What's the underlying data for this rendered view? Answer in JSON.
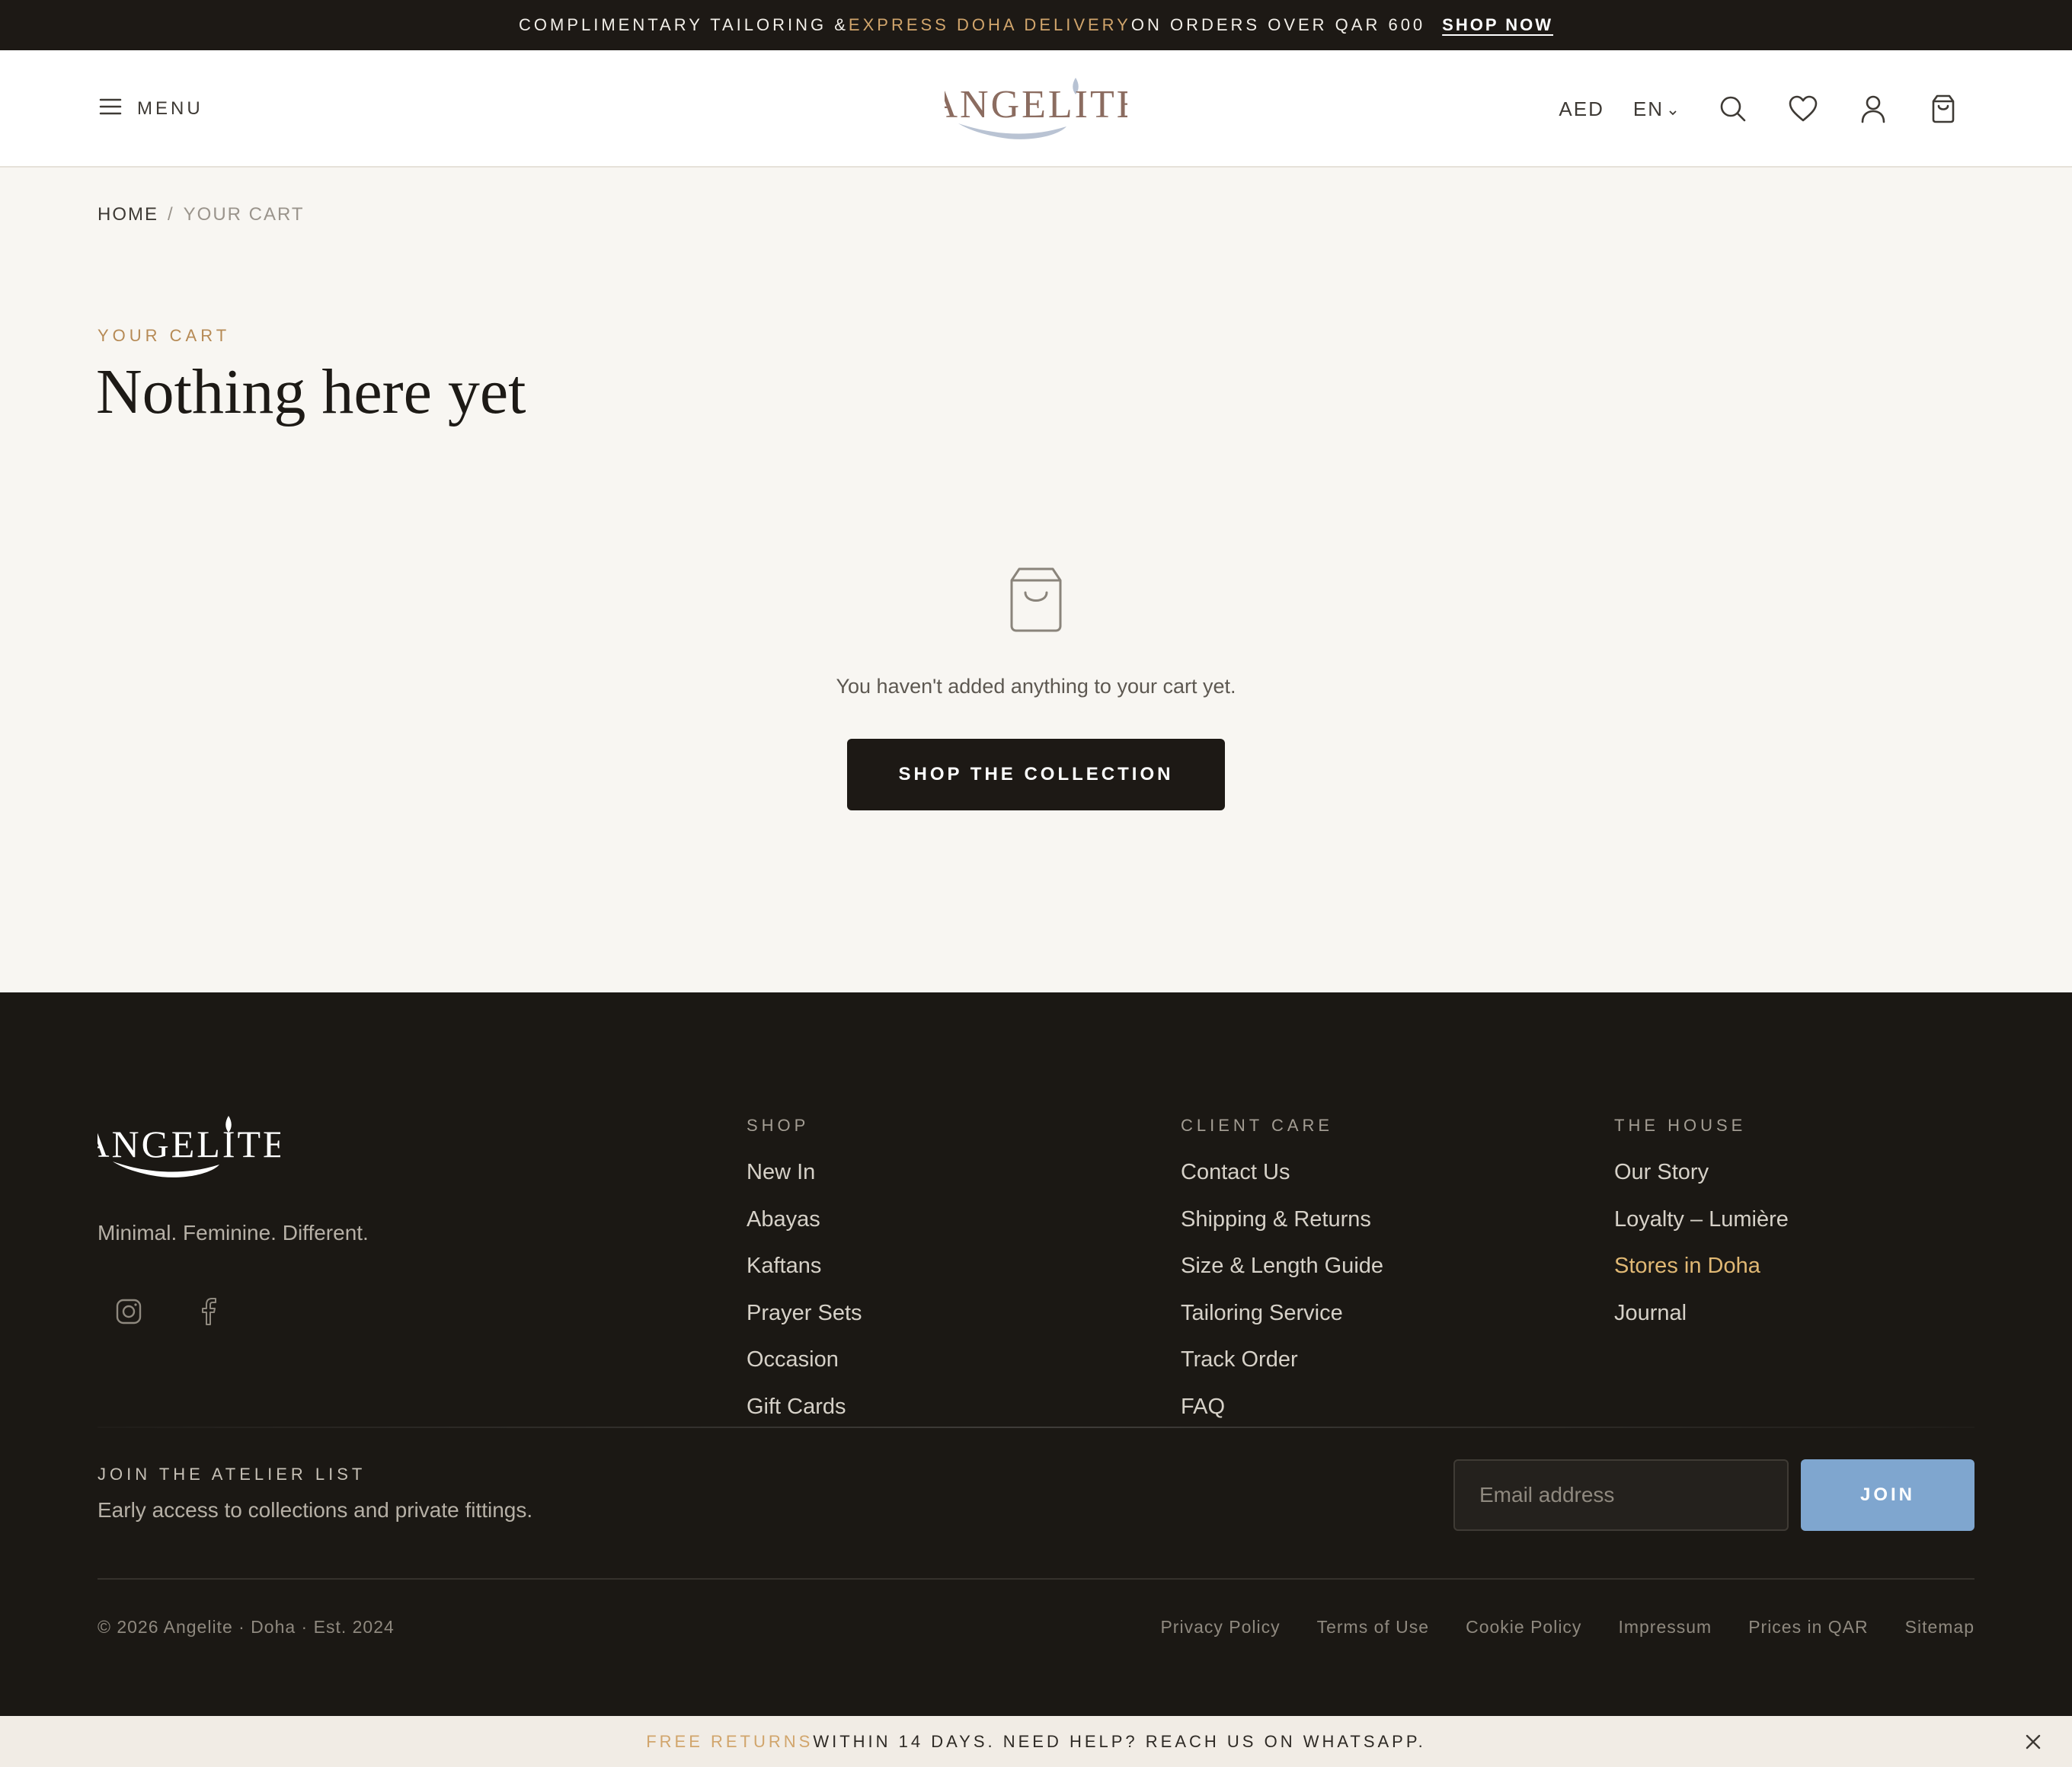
{
  "announcement": {
    "part1": "COMPLIMENTARY TAILORING & ",
    "accent": "EXPRESS DOHA DELIVERY",
    "part2": " ON ORDERS OVER QAR 600",
    "link": "SHOP NOW"
  },
  "header": {
    "menu_label": "MENU",
    "logo_text": "ANGELITE",
    "currency": "AED",
    "language": "EN",
    "icons": [
      "search-icon",
      "heart-icon",
      "user-icon",
      "bag-icon"
    ]
  },
  "breadcrumb": {
    "home": "HOME",
    "separator": "/",
    "current": "YOUR CART"
  },
  "cart": {
    "eyebrow": "YOUR CART",
    "title": "Nothing here yet",
    "empty_message": "You haven't added anything to your cart yet.",
    "cta": "SHOP THE COLLECTION"
  },
  "footer": {
    "logo_text": "ANGELITE",
    "tagline": "Minimal. Feminine. Different.",
    "social": [
      "instagram-icon",
      "facebook-icon"
    ],
    "columns": [
      {
        "heading": "SHOP",
        "items": [
          "New In",
          "Abayas",
          "Kaftans",
          "Prayer Sets",
          "Occasion",
          "Gift Cards"
        ]
      },
      {
        "heading": "CLIENT CARE",
        "items": [
          "Contact Us",
          "Shipping & Returns",
          "Size & Length Guide",
          "Tailoring Service",
          "Track Order",
          "FAQ"
        ]
      },
      {
        "heading": "THE HOUSE",
        "items": [
          "Our Story",
          "Loyalty – Lumière",
          "Stores in Doha",
          "Journal"
        ]
      }
    ],
    "newsletter": {
      "label": "JOIN THE ATELIER LIST",
      "text": "Early access to collections and private fittings.",
      "placeholder": "Email address",
      "button": "JOIN"
    },
    "copyright": "© 2026 Angelite · Doha · Est. 2024",
    "legal": [
      "Privacy Policy",
      "Terms of Use",
      "Cookie Policy",
      "Impressum",
      "Prices in QAR",
      "Sitemap"
    ]
  },
  "bottom_bar": {
    "accent": "FREE RETURNS",
    "text": " WITHIN 14 DAYS. NEED HELP? REACH US ON WHATSAPP."
  },
  "colors": {
    "accent_gold": "#d1a56c",
    "dark": "#1d1915",
    "join_blue": "#7fa6cf",
    "background": "#f8f6f2"
  }
}
